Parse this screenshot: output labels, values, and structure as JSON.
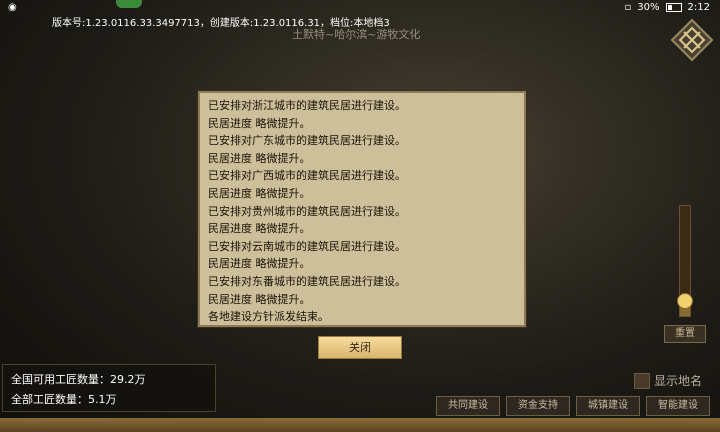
{
  "status_bar": {
    "battery": "30%",
    "time": "2:12"
  },
  "header": {
    "version": "版本号:1.23.0116.33.3497713，创建版本:1.23.0116.31，档位:本地档3",
    "watermark": "土默特~哈尔滨~游牧文化"
  },
  "dialog": {
    "lines": [
      "已安排对浙江城市的建筑民居进行建设。",
      "民居进度 略微提升。",
      "已安排对广东城市的建筑民居进行建设。",
      "民居进度 略微提升。",
      "已安排对广西城市的建筑民居进行建设。",
      "民居进度 略微提升。",
      "已安排对贵州城市的建筑民居进行建设。",
      "民居进度 略微提升。",
      "已安排对云南城市的建筑民居进行建设。",
      "民居进度 略微提升。",
      "已安排对东番城市的建筑民居进行建设。",
      "民居进度 略微提升。",
      "各地建设方针派发结束。"
    ],
    "close_label": "关闭"
  },
  "stats": {
    "available_craftsmen": "全国可用工匠数量：29.2万",
    "total_craftsmen": "全部工匠数量：5.1万"
  },
  "zoom": {
    "level": 0.15,
    "reset_label": "重置"
  },
  "toggles": {
    "show_place_names": "显示地名"
  },
  "bottom_buttons": [
    "共同建设",
    "资金支持",
    "城镇建设",
    "智能建设"
  ],
  "colors": {
    "dialog_bg": "#cdbf9a",
    "close_button": "#e8c880"
  }
}
